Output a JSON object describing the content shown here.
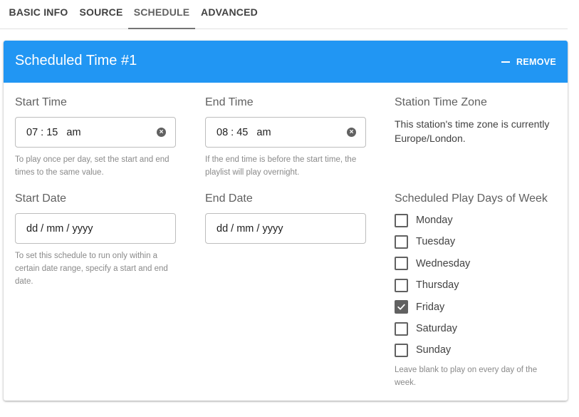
{
  "tabs": [
    {
      "label": "BASIC INFO"
    },
    {
      "label": "SOURCE"
    },
    {
      "label": "SCHEDULE",
      "active": true
    },
    {
      "label": "ADVANCED"
    }
  ],
  "card": {
    "title": "Scheduled Time #1",
    "remove_label": "REMOVE",
    "header_color": "#2196f3"
  },
  "start_time": {
    "label": "Start Time",
    "value": "07 : 15   am",
    "hint": "To play once per day, set the start and end times to the same value."
  },
  "end_time": {
    "label": "End Time",
    "value": "08 : 45   am",
    "hint": "If the end time is before the start time, the playlist will play overnight."
  },
  "timezone": {
    "label": "Station Time Zone",
    "text": "This station's time zone is currently Europe/London."
  },
  "start_date": {
    "label": "Start Date",
    "placeholder": "dd / mm / yyyy",
    "hint": "To set this schedule to run only within a certain date range, specify a start and end date."
  },
  "end_date": {
    "label": "End Date",
    "placeholder": "dd / mm / yyyy"
  },
  "days": {
    "label": "Scheduled Play Days of Week",
    "items": [
      {
        "label": "Monday",
        "checked": false
      },
      {
        "label": "Tuesday",
        "checked": false
      },
      {
        "label": "Wednesday",
        "checked": false
      },
      {
        "label": "Thursday",
        "checked": false
      },
      {
        "label": "Friday",
        "checked": true
      },
      {
        "label": "Saturday",
        "checked": false
      },
      {
        "label": "Sunday",
        "checked": false
      }
    ],
    "hint": "Leave blank to play on every day of the week."
  }
}
